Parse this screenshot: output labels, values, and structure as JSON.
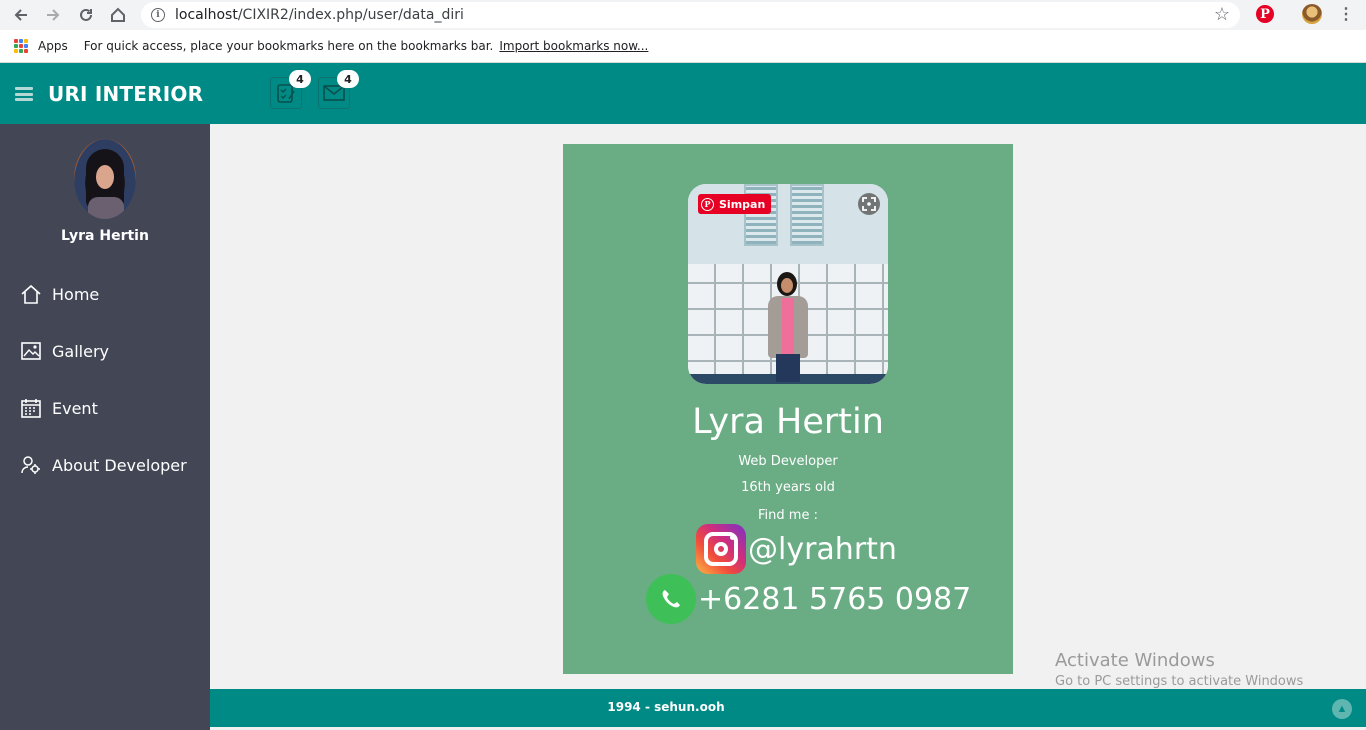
{
  "browser": {
    "url_host": "localhost",
    "url_path": "/CIXIR2/index.php/user/data_diri",
    "bookmarks": {
      "apps_label": "Apps",
      "hint": "For quick access, place your bookmarks here on the bookmarks bar.",
      "import_link": "Import bookmarks now..."
    }
  },
  "header": {
    "brand": "URI INTERIOR",
    "tasks_badge": "4",
    "mail_badge": "4",
    "color": "#008a85"
  },
  "sidebar": {
    "user_name": "Lyra Hertin",
    "items": [
      {
        "label": "Home",
        "icon": "home-icon"
      },
      {
        "label": "Gallery",
        "icon": "gallery-icon"
      },
      {
        "label": "Event",
        "icon": "calendar-icon"
      },
      {
        "label": "About Developer",
        "icon": "developer-icon"
      }
    ]
  },
  "profile": {
    "pin_save_label": "Simpan",
    "name": "Lyra Hertin",
    "role": "Web Developer",
    "age": "16th years old",
    "find_me": "Find me :",
    "instagram": "@lyrahrtn",
    "phone": "+6281 5765 0987",
    "card_color": "#6aac84"
  },
  "footer": {
    "text": "1994 - sehun.ooh"
  },
  "watermark": {
    "title": "Activate Windows",
    "subtitle": "Go to PC settings to activate Windows"
  }
}
